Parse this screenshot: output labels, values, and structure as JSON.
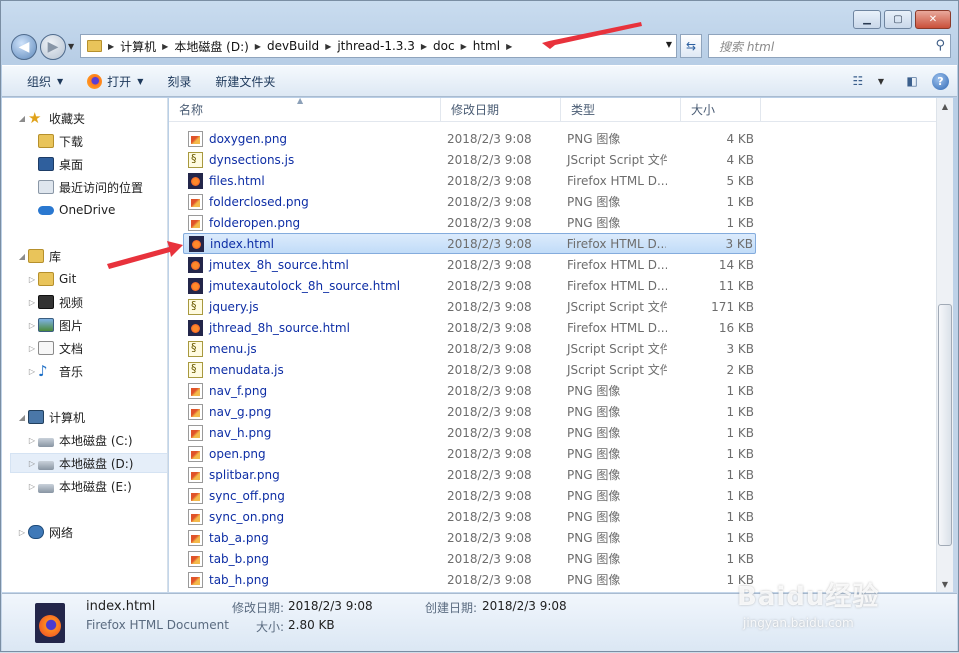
{
  "window": {
    "min": "▁",
    "max": "▢",
    "close": "✕"
  },
  "address": {
    "crumbs": [
      "计算机",
      "本地磁盘 (D:)",
      "devBuild",
      "jthread-1.3.3",
      "doc",
      "html"
    ]
  },
  "search": {
    "placeholder": "搜索 html"
  },
  "toolbar": {
    "organize": "组织",
    "open": "打开",
    "burn": "刻录",
    "new_folder": "新建文件夹"
  },
  "nav": {
    "favorites": "收藏夹",
    "downloads": "下载",
    "desktop": "桌面",
    "recent": "最近访问的位置",
    "onedrive": "OneDrive",
    "libraries": "库",
    "git": "Git",
    "videos": "视频",
    "pictures": "图片",
    "documents": "文档",
    "music": "音乐",
    "computer": "计算机",
    "drive_c": "本地磁盘 (C:)",
    "drive_d": "本地磁盘 (D:)",
    "drive_e": "本地磁盘 (E:)",
    "network": "网络"
  },
  "columns": {
    "name": "名称",
    "date": "修改日期",
    "type": "类型",
    "size": "大小"
  },
  "files": [
    {
      "name": "doxygen.png",
      "date": "2018/2/3 9:08",
      "type": "PNG 图像",
      "size": "4 KB",
      "icon": "png"
    },
    {
      "name": "dynsections.js",
      "date": "2018/2/3 9:08",
      "type": "JScript Script 文件",
      "size": "4 KB",
      "icon": "js"
    },
    {
      "name": "files.html",
      "date": "2018/2/3 9:08",
      "type": "Firefox HTML D...",
      "size": "5 KB",
      "icon": "html"
    },
    {
      "name": "folderclosed.png",
      "date": "2018/2/3 9:08",
      "type": "PNG 图像",
      "size": "1 KB",
      "icon": "png"
    },
    {
      "name": "folderopen.png",
      "date": "2018/2/3 9:08",
      "type": "PNG 图像",
      "size": "1 KB",
      "icon": "png"
    },
    {
      "name": "index.html",
      "date": "2018/2/3 9:08",
      "type": "Firefox HTML D...",
      "size": "3 KB",
      "icon": "html",
      "selected": true
    },
    {
      "name": "jmutex_8h_source.html",
      "date": "2018/2/3 9:08",
      "type": "Firefox HTML D...",
      "size": "14 KB",
      "icon": "html"
    },
    {
      "name": "jmutexautolock_8h_source.html",
      "date": "2018/2/3 9:08",
      "type": "Firefox HTML D...",
      "size": "11 KB",
      "icon": "html"
    },
    {
      "name": "jquery.js",
      "date": "2018/2/3 9:08",
      "type": "JScript Script 文件",
      "size": "171 KB",
      "icon": "js"
    },
    {
      "name": "jthread_8h_source.html",
      "date": "2018/2/3 9:08",
      "type": "Firefox HTML D...",
      "size": "16 KB",
      "icon": "html"
    },
    {
      "name": "menu.js",
      "date": "2018/2/3 9:08",
      "type": "JScript Script 文件",
      "size": "3 KB",
      "icon": "js"
    },
    {
      "name": "menudata.js",
      "date": "2018/2/3 9:08",
      "type": "JScript Script 文件",
      "size": "2 KB",
      "icon": "js"
    },
    {
      "name": "nav_f.png",
      "date": "2018/2/3 9:08",
      "type": "PNG 图像",
      "size": "1 KB",
      "icon": "png"
    },
    {
      "name": "nav_g.png",
      "date": "2018/2/3 9:08",
      "type": "PNG 图像",
      "size": "1 KB",
      "icon": "png"
    },
    {
      "name": "nav_h.png",
      "date": "2018/2/3 9:08",
      "type": "PNG 图像",
      "size": "1 KB",
      "icon": "png"
    },
    {
      "name": "open.png",
      "date": "2018/2/3 9:08",
      "type": "PNG 图像",
      "size": "1 KB",
      "icon": "png"
    },
    {
      "name": "splitbar.png",
      "date": "2018/2/3 9:08",
      "type": "PNG 图像",
      "size": "1 KB",
      "icon": "png"
    },
    {
      "name": "sync_off.png",
      "date": "2018/2/3 9:08",
      "type": "PNG 图像",
      "size": "1 KB",
      "icon": "png"
    },
    {
      "name": "sync_on.png",
      "date": "2018/2/3 9:08",
      "type": "PNG 图像",
      "size": "1 KB",
      "icon": "png"
    },
    {
      "name": "tab_a.png",
      "date": "2018/2/3 9:08",
      "type": "PNG 图像",
      "size": "1 KB",
      "icon": "png"
    },
    {
      "name": "tab_b.png",
      "date": "2018/2/3 9:08",
      "type": "PNG 图像",
      "size": "1 KB",
      "icon": "png"
    },
    {
      "name": "tab_h.png",
      "date": "2018/2/3 9:08",
      "type": "PNG 图像",
      "size": "1 KB",
      "icon": "png"
    }
  ],
  "details": {
    "filename": "index.html",
    "filetype": "Firefox HTML Document",
    "modified_label": "修改日期:",
    "modified": "2018/2/3 9:08",
    "created_label": "创建日期:",
    "created": "2018/2/3 9:08",
    "size_label": "大小:",
    "size": "2.80 KB"
  },
  "watermark": {
    "brand": "Baidu经验",
    "url": "jingyan.baidu.com"
  },
  "colors": {
    "arrow": "#e8323c",
    "link": "#0e2ea5",
    "selection": "#c1dcf8"
  }
}
